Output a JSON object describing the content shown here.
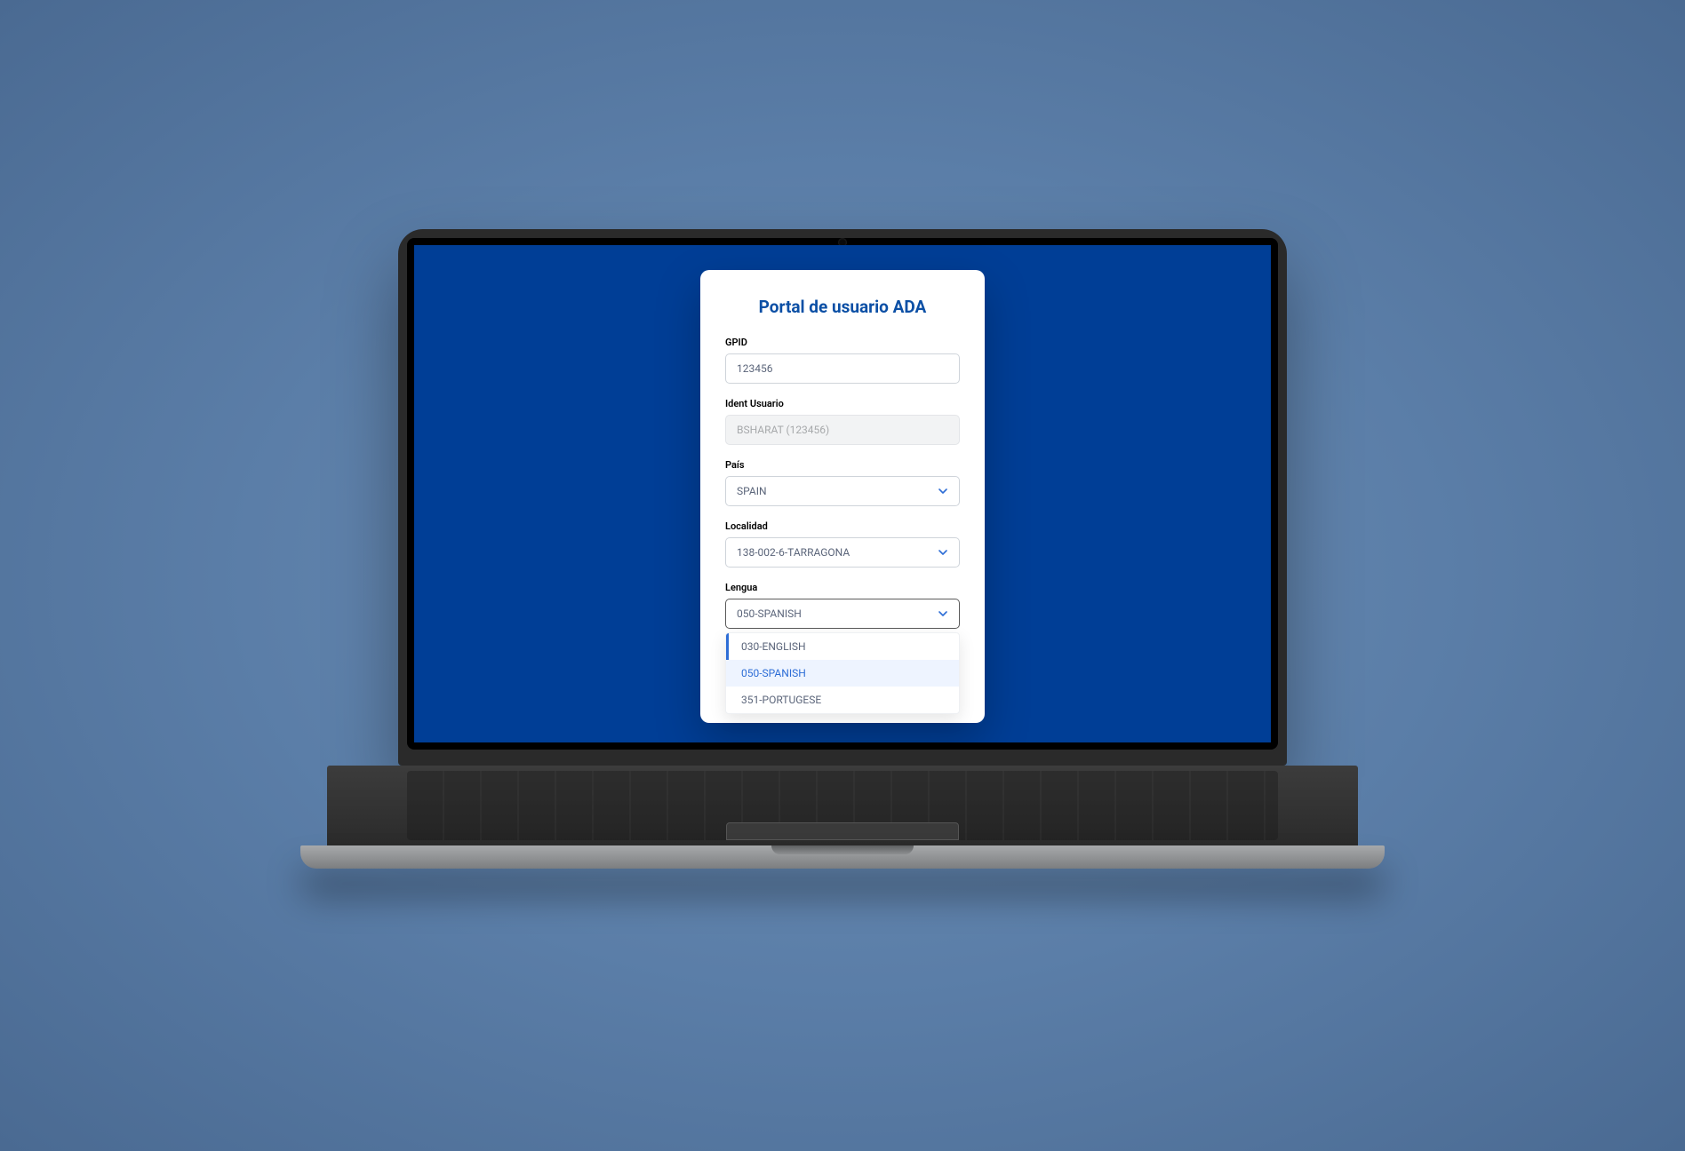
{
  "portal": {
    "title": "Portal de usuario ADA",
    "fields": {
      "gpid": {
        "label": "GPID",
        "value": "123456"
      },
      "ident": {
        "label": "Ident Usuario",
        "value": "BSHARAT (123456)"
      },
      "pais": {
        "label": "País",
        "value": "SPAIN"
      },
      "localidad": {
        "label": "Localidad",
        "value": "138-002-6-TARRAGONA"
      },
      "lengua": {
        "label": "Lengua",
        "value": "050-SPANISH",
        "options": [
          "030-ENGLISH",
          "050-SPANISH",
          "351-PORTUGESE"
        ]
      }
    }
  },
  "colors": {
    "brand": "#0b4fa5",
    "screen_bg": "#003e96",
    "accent": "#2d6dd6"
  }
}
